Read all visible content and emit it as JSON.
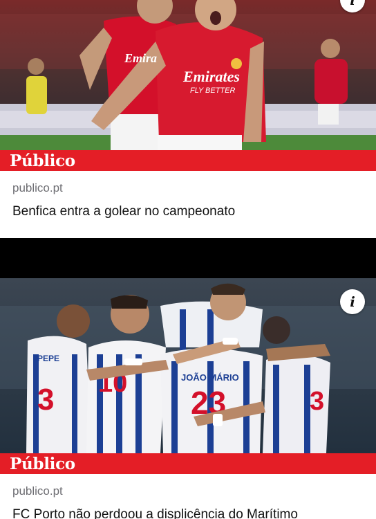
{
  "cards": [
    {
      "image_alt": "Benfica players celebrating a goal",
      "publisher_logo": "Público",
      "source": "publico.pt",
      "headline": "Benfica entra a golear no campeonato",
      "info_icon": "info-icon",
      "shirt_text": "Emirates FLY BETTER"
    },
    {
      "image_alt": "FC Porto players embracing after a goal",
      "publisher_logo": "Público",
      "source": "publico.pt",
      "headline": "FC Porto não perdoou a displicência do Marítimo",
      "info_icon": "info-icon",
      "shirt_names": [
        "PEPE",
        "JOÃO MÁRIO"
      ],
      "shirt_numbers": [
        "3",
        "10",
        "23",
        "3"
      ]
    }
  ],
  "colors": {
    "brand_red": "#e41e26",
    "benfica_red": "#d3102a",
    "porto_blue": "#1c3f94"
  }
}
